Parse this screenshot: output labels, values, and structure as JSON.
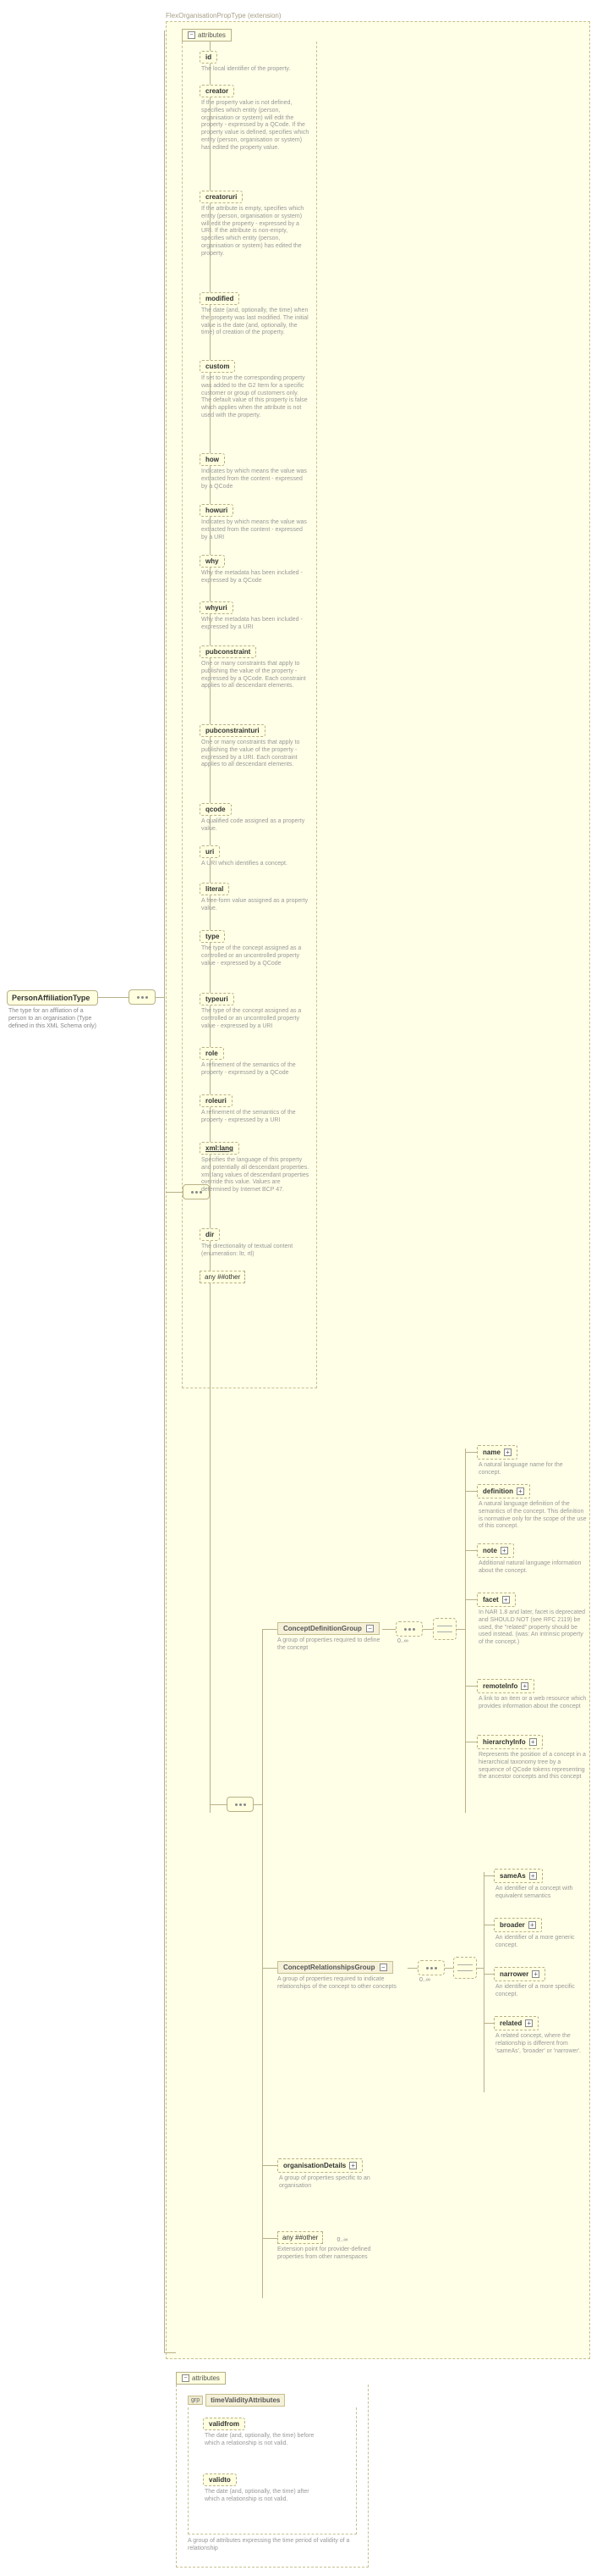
{
  "extension": {
    "label": "FlexOrganisationPropType (extension)"
  },
  "root": {
    "title": "PersonAffiliationType",
    "desc": "The type for an affliation of a person to an organisation (Type defined in this XML Schema only)"
  },
  "attributesHeader": "attributes",
  "attrs": [
    {
      "name": "id",
      "desc": "The local identifier of the property."
    },
    {
      "name": "creator",
      "desc": "If the property value is not defined, specifies which entity (person, organisation or system) will edit the property - expressed by a QCode. If the property value is defined, specifies which entity (person, organisation or system) has edited the property value."
    },
    {
      "name": "creatoruri",
      "desc": "If the attribute is empty, specifies which entity (person, organisation or system) will edit the property - expressed by a URI. If the attribute is non-empty, specifies which entity (person, organisation or system) has edited the property."
    },
    {
      "name": "modified",
      "desc": "The date (and, optionally, the time) when the property was last modified. The initial value is the date (and, optionally, the time) of creation of the property."
    },
    {
      "name": "custom",
      "desc": "If set to true the corresponding property was added to the G2 Item for a specific customer or group of customers only. The default value of this property is false which applies when the attribute is not used with the property."
    },
    {
      "name": "how",
      "desc": "Indicates by which means the value was extracted from the content - expressed by a QCode"
    },
    {
      "name": "howuri",
      "desc": "Indicates by which means the value was extracted from the content - expressed by a URI"
    },
    {
      "name": "why",
      "desc": "Why the metadata has been included - expressed by a QCode"
    },
    {
      "name": "whyuri",
      "desc": "Why the metadata has been included - expressed by a URI"
    },
    {
      "name": "pubconstraint",
      "desc": "One or many constraints that apply to publishing the value of the property - expressed by a QCode. Each constraint applies to all descendant elements."
    },
    {
      "name": "pubconstrainturi",
      "desc": "One or many constraints that apply to publishing the value of the property - expressed by a URI. Each constraint applies to all descendant elements."
    },
    {
      "name": "qcode",
      "desc": "A qualified code assigned as a property value."
    },
    {
      "name": "uri",
      "desc": "A URI which identifies a concept."
    },
    {
      "name": "literal",
      "desc": "A free-form value assigned as a property value."
    },
    {
      "name": "type",
      "desc": "The type of the concept assigned as a controlled or an uncontrolled property value - expressed by a QCode"
    },
    {
      "name": "typeuri",
      "desc": "The type of the concept assigned as a controlled or an uncontrolled property value - expressed by a URI"
    },
    {
      "name": "role",
      "desc": "A refinement of the semantics of the property - expressed by a QCode"
    },
    {
      "name": "roleuri",
      "desc": "A refinement of the semantics of the property - expressed by a URI"
    },
    {
      "name": "xml:lang",
      "desc": "Specifies the language of this property and potentially all descendant properties. xml:lang values of descendant properties override this value. Values are determined by Internet BCP 47."
    },
    {
      "name": "dir",
      "desc": "The directionality of textual content (enumeration: ltr, rtl)"
    }
  ],
  "attrAny": "any ##other",
  "groups": {
    "conceptDef": {
      "label": "ConceptDefinitionGroup",
      "desc": "A group of properties required to define the concept",
      "children": [
        {
          "name": "name",
          "desc": "A natural language name for the concept."
        },
        {
          "name": "definition",
          "desc": "A natural language definition of the semantics of the concept. This definition is normative only for the scope of the use of this concept."
        },
        {
          "name": "note",
          "desc": "Additional natural language information about the concept."
        },
        {
          "name": "facet",
          "desc": "In NAR 1.8 and later, facet is deprecated and SHOULD NOT (see RFC 2119) be used, the \"related\" property should be used instead. (was: An intrinsic property of the concept.)"
        },
        {
          "name": "remoteInfo",
          "desc": "A link to an item or a web resource which provides information about the concept"
        },
        {
          "name": "hierarchyInfo",
          "desc": "Represents the position of a concept in a hierarchical taxonomy tree by a sequence of QCode tokens representing the ancestor concepts and this concept"
        }
      ]
    },
    "conceptRel": {
      "label": "ConceptRelationshipsGroup",
      "desc": "A group of properties required to indicate relationships of the concept to other concepts",
      "children": [
        {
          "name": "sameAs",
          "desc": "An identifier of a concept with equivalent semantics"
        },
        {
          "name": "broader",
          "desc": "An identifier of a more generic concept."
        },
        {
          "name": "narrower",
          "desc": "An identifier of a more specific concept."
        },
        {
          "name": "related",
          "desc": "A related concept, where the relationship is different from 'sameAs', 'broader' or 'narrower'."
        }
      ]
    }
  },
  "orgDetails": {
    "name": "organisationDetails",
    "desc": "A group of properties specific to an organisation"
  },
  "anyElem": {
    "box": "any ##other",
    "occurs": "0..∞",
    "desc": "Extension point for provider-defined properties from other namespaces"
  },
  "timeValidity": {
    "groupLabel": "timeValidityAttributes",
    "grpTag": "grp",
    "attrsHeader": "attributes",
    "attrs": [
      {
        "name": "validfrom",
        "desc": "The date (and, optionally, the time) before which a relationship is not valid."
      },
      {
        "name": "validto",
        "desc": "The date (and, optionally, the time) after which a relationship is not valid."
      }
    ],
    "groupDesc": "A group of attributes expressing the time period of validity of a relationship"
  },
  "occurs": "0..∞"
}
